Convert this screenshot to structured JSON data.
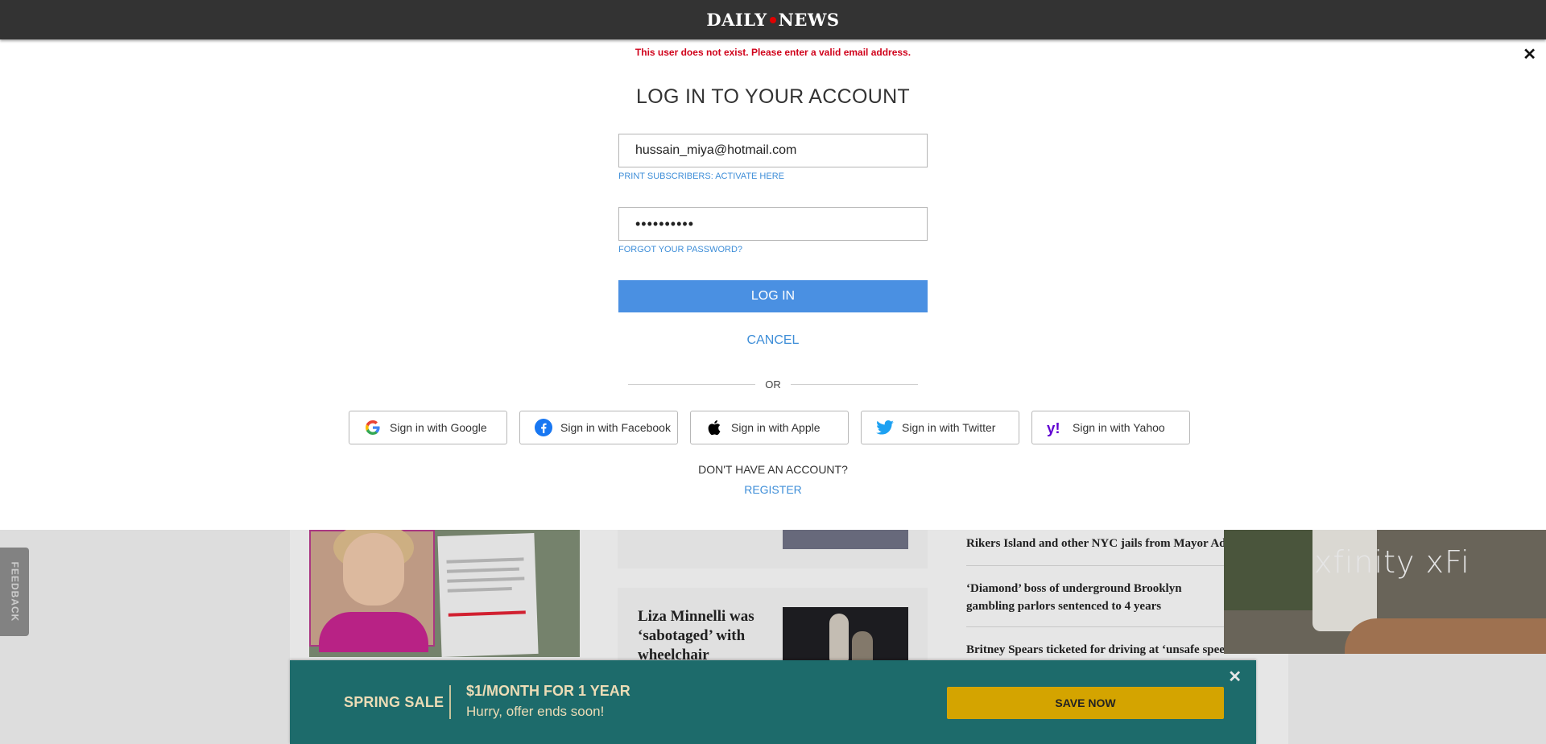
{
  "header": {
    "logo_left": "DAILY",
    "logo_right": "NEWS"
  },
  "login": {
    "error": "This user does not exist. Please enter a valid email address.",
    "title": "LOG IN TO YOUR ACCOUNT",
    "email_value": "hussain_miya@hotmail.com",
    "password_masked": "••••••••••",
    "print_link": "PRINT SUBSCRIBERS: ACTIVATE HERE",
    "forgot_link": "FORGOT YOUR PASSWORD?",
    "login_button": "LOG IN",
    "cancel": "CANCEL",
    "or": "OR",
    "social": {
      "google": "Sign in with Google",
      "facebook": "Sign in with Facebook",
      "apple": "Sign in with Apple",
      "twitter": "Sign in with Twitter",
      "yahoo": "Sign in with Yahoo"
    },
    "no_account": "DON'T HAVE AN ACCOUNT?",
    "register": "REGISTER",
    "close_icon": "close-icon"
  },
  "background": {
    "feedback": "FEEDBACK",
    "card_headline": "Liza Minnelli was ‘sabotaged’ with wheelchair",
    "news": [
      "Rikers Island and other NYC jails from Mayor Adams",
      "‘Diamond’ boss of underground Brooklyn gambling parlors sentenced to 4 years",
      "Britney Spears ticketed for driving at ‘unsafe speed’"
    ],
    "ad_text": "xfinity xFi"
  },
  "promo": {
    "label": "SPRING SALE",
    "offer": "$1/MONTH FOR 1 YEAR",
    "sub": "Hurry, offer ends soon!",
    "button": "SAVE NOW"
  },
  "colors": {
    "accent": "#4a90e2",
    "link": "#3e8ed8",
    "error": "#d0021b",
    "promo_bg": "#1d6b6b",
    "promo_button": "#d4a400"
  }
}
